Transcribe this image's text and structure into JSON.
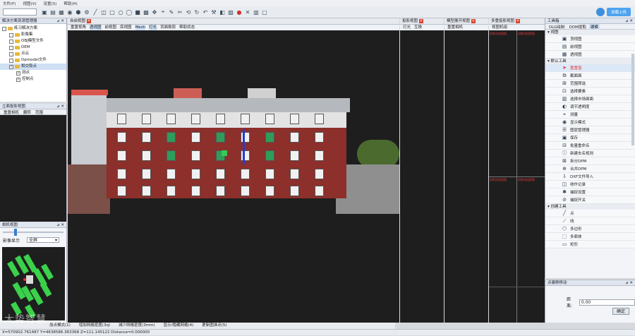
{
  "menu": [
    "文件(F)",
    "视图(V)",
    "设置(S)",
    "帮助(H)"
  ],
  "toolbar": {
    "icons": [
      "open-icon",
      "save-icon",
      "grid-icon",
      "dot-icon",
      "polygon-icon",
      "settings-icon",
      "line-icon",
      "box-icon",
      "square-icon",
      "circle-icon",
      "circle-icon",
      "square-icon",
      "grid-icon",
      "move-icon",
      "measure-icon",
      "edit-icon",
      "cut-icon",
      "rotate-icon",
      "refresh-icon",
      "undo-icon",
      "tools-icon",
      "layer-icon",
      "photo-icon",
      "record-icon",
      "cross-icon",
      "layout-icon"
    ],
    "login_button": "加载上传"
  },
  "solution_panel": {
    "title": "解决方案资源管理器",
    "items": [
      {
        "label": "练习解决方案",
        "level": 0,
        "type": "folder"
      },
      {
        "label": "影像集",
        "level": 1,
        "type": "folder"
      },
      {
        "label": "OBJ模型文件",
        "level": 1,
        "type": "folder"
      },
      {
        "label": "DEM",
        "level": 1,
        "type": "folder"
      },
      {
        "label": "点云",
        "level": 1,
        "type": "folder"
      },
      {
        "label": "Dpmodel文件",
        "level": 1,
        "type": "folder"
      },
      {
        "label": "相交取点",
        "level": 1,
        "type": "folder"
      },
      {
        "label": "测点",
        "level": 2,
        "type": "check"
      },
      {
        "label": "控制点",
        "level": 2,
        "type": "check"
      }
    ]
  },
  "stereo_panel": {
    "title": "立面投影视图",
    "tabs": [
      "重置相机",
      "翻转",
      "范围"
    ]
  },
  "camera_panel": {
    "title": "相机视图",
    "label": "影像显示",
    "select_value": "全屏"
  },
  "free_view": {
    "title": "自由视图",
    "tabs": [
      "重置视角",
      "透视图",
      "前视图",
      "库视图",
      "Mesh",
      "灯光",
      "背面裁剪",
      "帮助状态"
    ]
  },
  "proj_view": {
    "title": "投影视图",
    "tabs": [
      "灯光",
      "互换"
    ]
  },
  "model_view": {
    "title": "模型展开视图",
    "tabs": [
      "重置相机"
    ]
  },
  "multi_view": {
    "title": "多重投影视图",
    "tabs": [
      "视图机组"
    ],
    "red_labels": [
      "投影机组视图",
      "投影机组视图",
      "投影机组视图",
      "投影机组视图"
    ]
  },
  "tools_panel": {
    "title": "工具箱",
    "tabs": [
      "DLG绘制",
      "DOM提取",
      "建模"
    ],
    "sections": [
      {
        "title": "视图",
        "items": [
          {
            "label": "顶视图",
            "icon": "top-view-icon"
          },
          {
            "label": "前视图",
            "icon": "front-view-icon"
          },
          {
            "label": "透视图",
            "icon": "perspective-icon"
          }
        ]
      },
      {
        "title": "默认工具",
        "items": [
          {
            "label": "重置窗",
            "icon": "cursor-icon",
            "selected": true
          },
          {
            "label": "截面面",
            "icon": "section-icon"
          },
          {
            "label": "范围筛选",
            "icon": "filter-icon"
          },
          {
            "label": "选择要素",
            "icon": "select-icon"
          },
          {
            "label": "选择市场面面",
            "icon": "plane-icon"
          },
          {
            "label": "调节透明度",
            "icon": "opacity-icon"
          },
          {
            "label": "测量",
            "icon": "measure-icon"
          },
          {
            "label": "显示模式",
            "icon": "eye-icon"
          },
          {
            "label": "图层管理器",
            "icon": "layers-icon"
          },
          {
            "label": "保存",
            "icon": "save-icon"
          },
          {
            "label": "批量重命名",
            "icon": "rename-icon"
          },
          {
            "label": "新建去名规则",
            "icon": "info-icon"
          },
          {
            "label": "拆分DPM",
            "icon": "split-icon"
          },
          {
            "label": "合并DPM",
            "icon": "merge-icon"
          },
          {
            "label": "DXF文件导入",
            "icon": "import-icon"
          },
          {
            "label": "绕作记录",
            "icon": "record-icon"
          },
          {
            "label": "捕捉设置",
            "icon": "snap-icon"
          },
          {
            "label": "捕捉开关",
            "icon": "toggle-icon"
          }
        ]
      },
      {
        "title": "创建工具",
        "items": [
          {
            "label": "点",
            "icon": "pen-icon"
          },
          {
            "label": "线",
            "icon": "line-icon"
          },
          {
            "label": "多边形",
            "icon": "polygon-icon"
          },
          {
            "label": "多面体",
            "icon": "cube-icon"
          },
          {
            "label": "矩形",
            "icon": "rect-icon"
          }
        ]
      }
    ]
  },
  "offset_panel": {
    "title": "点偏移移动",
    "distance_label": "距离:",
    "distance_value": "0.00",
    "confirm_button": "确定"
  },
  "modebar": [
    "加点模式(1)",
    "增加网格密度(3q)",
    "减少网格密度(3mm)",
    "显示/隐藏网格(4)",
    "更新图准点(5)"
  ],
  "statusbar": {
    "coords": "X=570902.761487  Y=4638586.363368  Z=111.145122  Distance=0.000000"
  },
  "watermark": "大势智慧"
}
